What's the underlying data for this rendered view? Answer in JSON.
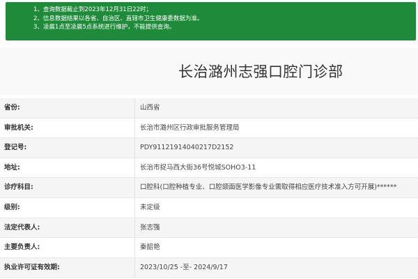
{
  "notice": {
    "lines": [
      "1、查询数据截止到2023年12月31日22时；",
      "2、信息数据结果以各省、自治区、直辖市卫生健康委数据为准。",
      "3、凌晨1点至凌晨5点系统进行维护，不能提供查询。"
    ]
  },
  "clinic": {
    "name": "长治潞州志强口腔门诊部"
  },
  "details": [
    {
      "label": "省份:",
      "value": "山西省"
    },
    {
      "label": "审批机关:",
      "value": "长治市潞州区行政审批服务管理局"
    },
    {
      "label": "登记号:",
      "value": "PDY91121914040217D2152"
    },
    {
      "label": "地址:",
      "value": "长治市捉马西大街36号悦城SOHO3-11"
    },
    {
      "label": "诊疗科目:",
      "value": "口腔科(口腔种植专业、口腔颌面医学影像专业需取得相应医疗技术准入方可开展)******"
    },
    {
      "label": "级别:",
      "value": "未定级"
    },
    {
      "label": "法定代表人:",
      "value": "张志强"
    },
    {
      "label": "主要负责人:",
      "value": "秦韶艳"
    },
    {
      "label": "执业许可证有效期:",
      "value": "2023/10/25 -至- 2024/9/17"
    }
  ],
  "colors": {
    "notice_bg": "#1e8a3a",
    "row_alt_bg": "#f5f5f5"
  }
}
